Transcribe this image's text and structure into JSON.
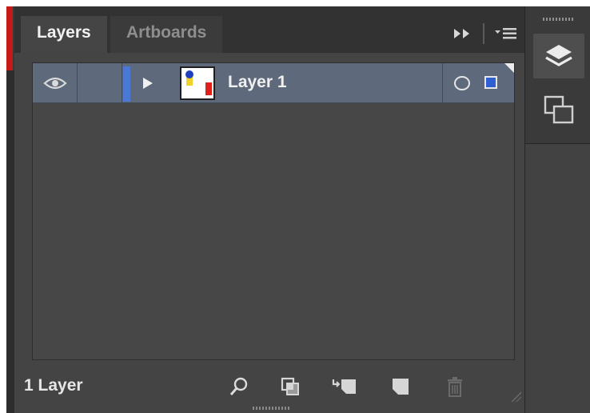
{
  "tabs": [
    {
      "label": "Layers",
      "active": true
    },
    {
      "label": "Artboards",
      "active": false
    }
  ],
  "tab_tools": {
    "expand_icon": "double-chevron-right-icon",
    "menu_icon": "panel-menu-icon"
  },
  "layers": [
    {
      "name": "Layer 1",
      "visible": true,
      "locked": false,
      "expanded": false,
      "color": "#4a78d4",
      "selected": true
    }
  ],
  "footer": {
    "count_label": "1 Layer",
    "buttons": [
      {
        "icon": "search-icon",
        "label": "Locate Object"
      },
      {
        "icon": "clipping-mask-icon",
        "label": "Make/Release Clipping Mask"
      },
      {
        "icon": "new-sublayer-icon",
        "label": "Create New Sublayer"
      },
      {
        "icon": "new-layer-icon",
        "label": "Create New Layer"
      },
      {
        "icon": "trash-icon",
        "label": "Delete Selection",
        "disabled": true
      }
    ]
  },
  "dock": {
    "buttons": [
      {
        "icon": "layers-stack-icon",
        "active": true
      },
      {
        "icon": "artboards-icon",
        "active": false
      }
    ]
  },
  "colors": {
    "panel_bg": "#444444",
    "selected_row": "#5e6a7b",
    "layer_color": "#4a78d4",
    "accent_red": "#c41a1a"
  }
}
